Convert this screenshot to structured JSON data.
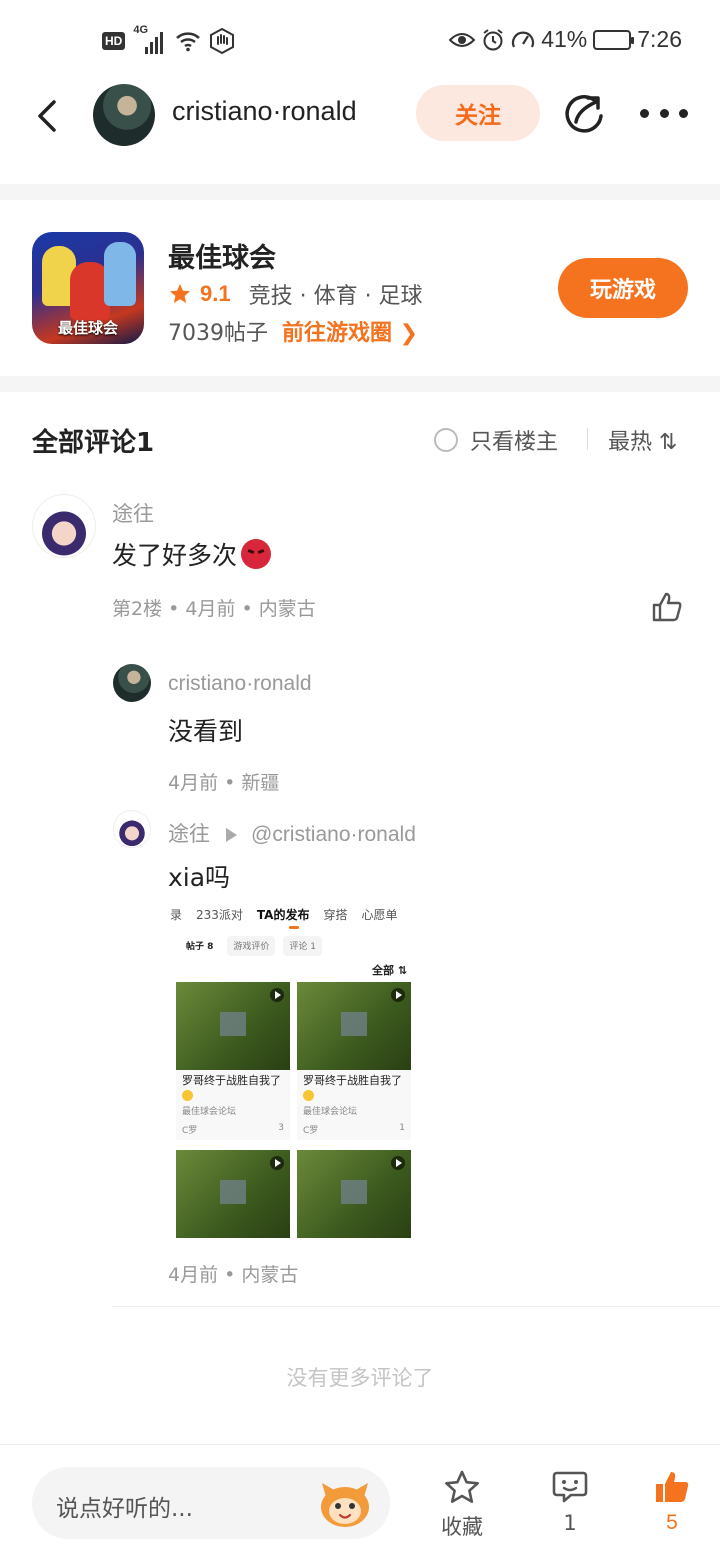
{
  "status_bar": {
    "hd": "HD",
    "network": "4G",
    "battery_pct": "41%",
    "battery_level": 0.41,
    "time": "7:26"
  },
  "header": {
    "username": "cristiano·ronald",
    "follow_label": "关注"
  },
  "game": {
    "icon_label": "最佳球会",
    "title": "最佳球会",
    "rating": "9.1",
    "tags": "竞技 · 体育 · 足球",
    "posts": "7039帖子",
    "go_circle": "前往游戏圈 ❯",
    "play_label": "玩游戏"
  },
  "comments": {
    "title": "全部评论1",
    "only_op": "只看楼主",
    "sort": "最热 ⇅"
  },
  "comment": {
    "author": "途往",
    "text": "发了好多次",
    "meta": "第2楼 • 4月前 • 内蒙古"
  },
  "replies": [
    {
      "author": "cristiano·ronald",
      "text": "没看到",
      "meta": "4月前 • 新疆"
    },
    {
      "author": "途往",
      "mention": "@cristiano·ronald",
      "text": "xia吗",
      "meta": "4月前 • 内蒙古"
    }
  ],
  "embedded_screenshot": {
    "tabs": [
      "录",
      "233派对",
      "TA的发布",
      "穿搭",
      "心愿单"
    ],
    "subtabs": [
      "帖子 8",
      "游戏评价",
      "评论 1"
    ],
    "filter": "全部 ⇅",
    "posts": [
      {
        "title": "罗哥终于战胜自我了",
        "forum": "最佳球会论坛",
        "user": "C罗",
        "likes": "3"
      },
      {
        "title": "罗哥终于战胜自我了",
        "forum": "最佳球会论坛",
        "user": "C罗",
        "likes": "1"
      }
    ]
  },
  "no_more_text": "没有更多评论了",
  "bottom_bar": {
    "input_placeholder": "说点好听的...",
    "favorite_label": "收藏",
    "comment_count": "1",
    "like_count": "5"
  },
  "colors": {
    "accent": "#f5731f",
    "follow_bg": "#fde8df"
  },
  "icons": [
    "back-icon",
    "share-icon",
    "more-icon",
    "star-icon",
    "chevron-right-icon",
    "radio-icon",
    "sort-icon",
    "thumbs-up-icon",
    "angry-emoji-icon",
    "play-icon",
    "favorite-star-icon",
    "comment-bubble-icon",
    "mascot-icon"
  ]
}
